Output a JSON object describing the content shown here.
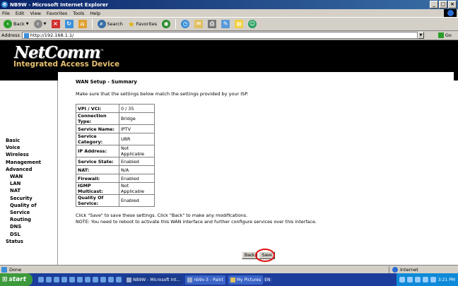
{
  "window": {
    "title": "NB9W - Microsoft Internet Explorer"
  },
  "menu": [
    "File",
    "Edit",
    "View",
    "Favorites",
    "Tools",
    "Help"
  ],
  "toolbar": {
    "back": "Back",
    "search": "Search",
    "favorites": "Favorites"
  },
  "address": {
    "label": "Address",
    "url": "http://192.168.1.1/",
    "go": "Go"
  },
  "banner": {
    "logo": "NetComm",
    "tagline": "Integrated Access Device"
  },
  "sidebar": {
    "items": [
      {
        "label": "Basic",
        "level": 1
      },
      {
        "label": "Voice",
        "level": 1
      },
      {
        "label": "Wireless",
        "level": 1
      },
      {
        "label": "Management",
        "level": 1
      },
      {
        "label": "Advanced",
        "level": 1
      },
      {
        "label": "WAN",
        "level": 2
      },
      {
        "label": "LAN",
        "level": 2
      },
      {
        "label": "NAT",
        "level": 2
      },
      {
        "label": "Security",
        "level": 2
      },
      {
        "label": "Quality of Service",
        "level": 2
      },
      {
        "label": "Routing",
        "level": 2
      },
      {
        "label": "DNS",
        "level": 2
      },
      {
        "label": "DSL",
        "level": 2
      },
      {
        "label": "Status",
        "level": 1
      }
    ]
  },
  "main": {
    "title": "WAN Setup - Summary",
    "intro": "Make sure that the settings below match the settings provided by your ISP.",
    "rows": [
      {
        "key": "VPI / VCI:",
        "value": "0 / 35"
      },
      {
        "key": "Connection Type:",
        "value": "Bridge"
      },
      {
        "key": "Service Name:",
        "value": "IPTV"
      },
      {
        "key": "Service Category:",
        "value": "UBR"
      },
      {
        "key": "IP Address:",
        "value": "Not Applicable"
      },
      {
        "key": "Service State:",
        "value": "Enabled"
      },
      {
        "key": "NAT:",
        "value": "N/A"
      },
      {
        "key": "Firewall:",
        "value": "Enabled"
      },
      {
        "key": "IGMP Multicast:",
        "value": "Not Applicable"
      },
      {
        "key": "Quality Of Service:",
        "value": "Enabled"
      }
    ],
    "note1": "Click \"Save\" to save these settings. Click \"Back\" to make any modifications.",
    "note2": "NOTE: You need to reboot to activate this WAN interface and further configure services over this interface.",
    "back_label": "Back",
    "save_label": "Save"
  },
  "statusbar": {
    "status": "Done",
    "zone": "Internet"
  },
  "taskbar": {
    "start": "start",
    "tasks": [
      "NB9W - Microsoft Int...",
      "nb9v-3 - Paint",
      "My Pictures"
    ],
    "lang": "EN",
    "clock": "3:21 PM"
  }
}
